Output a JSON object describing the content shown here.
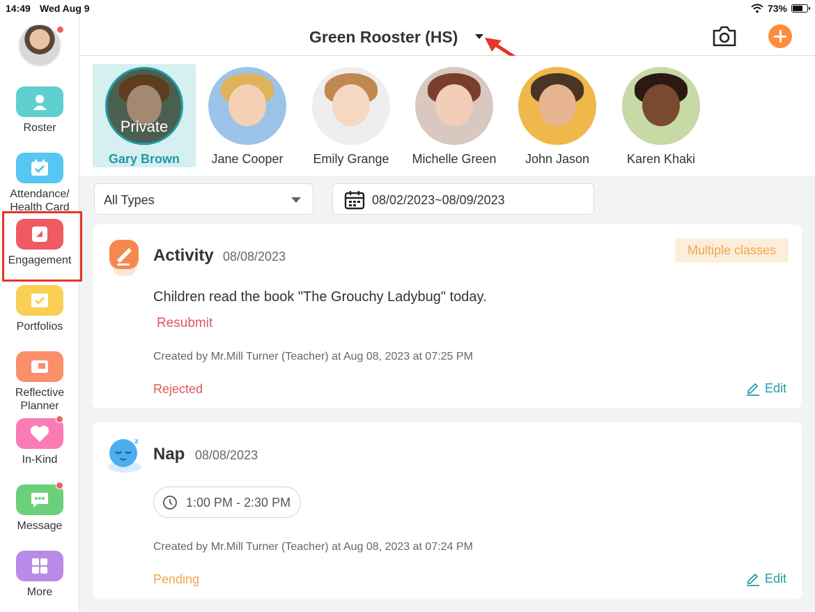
{
  "status_bar": {
    "time": "14:49",
    "date": "Wed Aug 9",
    "battery": "73%",
    "battery_level": 0.73
  },
  "sidebar": {
    "items": [
      {
        "label": "Roster",
        "icon": "roster-icon",
        "color": "#5fd0cf"
      },
      {
        "label": "Attendance/ Health Card",
        "icon": "calendar-check-icon",
        "color": "#56c6f4"
      },
      {
        "label": "Engagement",
        "icon": "engagement-icon",
        "color": "#f05a62"
      },
      {
        "label": "Portfolios",
        "icon": "portfolio-icon",
        "color": "#f9cf55"
      },
      {
        "label": "Reflective Planner",
        "icon": "planner-icon",
        "color": "#fb8f6b"
      },
      {
        "label": "In-Kind",
        "icon": "heart-icon",
        "color": "#fb7bb4"
      },
      {
        "label": "Message",
        "icon": "message-icon",
        "color": "#6ccf7a"
      },
      {
        "label": "More",
        "icon": "grid-icon",
        "color": "#b98be8"
      }
    ]
  },
  "header": {
    "title": "Green Rooster (HS)"
  },
  "children": [
    {
      "name": "Gary Brown",
      "private_label": "Private",
      "selected": true
    },
    {
      "name": "Jane Cooper"
    },
    {
      "name": "Emily Grange"
    },
    {
      "name": "Michelle Green"
    },
    {
      "name": "John Jason"
    },
    {
      "name": "Karen Khaki"
    }
  ],
  "filters": {
    "type": "All Types",
    "date_range": "08/02/2023~08/09/2023"
  },
  "cards": [
    {
      "title": "Activity",
      "date": "08/08/2023",
      "tag": "Multiple classes",
      "body": "Children read the book \"The Grouchy Ladybug\" today.",
      "resubmit": "Resubmit",
      "creator": "Created by Mr.Mill Turner (Teacher) at Aug 08, 2023 at 07:25 PM",
      "status": "Rejected",
      "status_color": "#e0575a",
      "edit": "Edit"
    },
    {
      "title": "Nap",
      "date": "08/08/2023",
      "time": "1:00 PM - 2:30 PM",
      "creator": "Created by Mr.Mill Turner (Teacher) at Aug 08, 2023 at 07:24 PM",
      "status": "Pending",
      "status_color": "#f0a64a",
      "edit": "Edit"
    }
  ]
}
